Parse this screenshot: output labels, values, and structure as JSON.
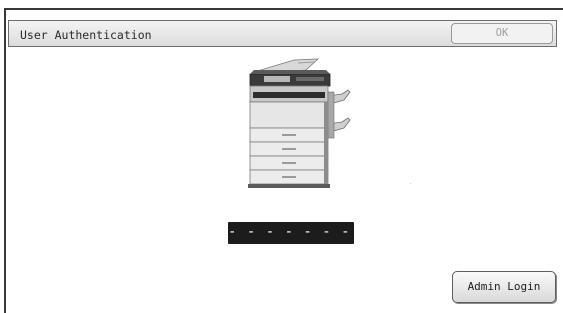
{
  "title": "User Authentication",
  "ok_button": {
    "label": "OK",
    "enabled": false
  },
  "password_field": {
    "value": "- - - - - - - -"
  },
  "admin_button": {
    "label": "Admin Login"
  },
  "colors": {
    "frame": "#3a3a3a",
    "password_bg": "#1c1c1c",
    "disabled_text": "#a0a0a0"
  },
  "icons": {
    "device": "multifunction-printer-icon"
  }
}
